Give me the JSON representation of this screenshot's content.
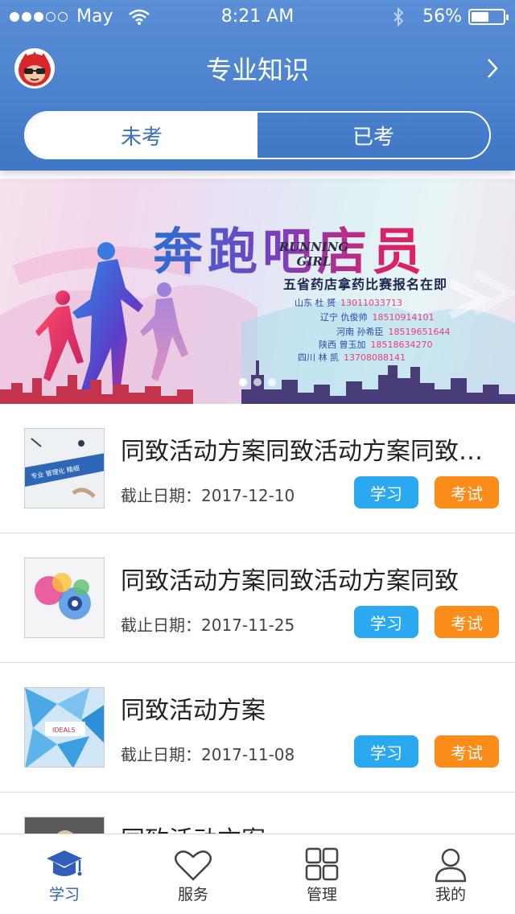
{
  "status_bar": {
    "carrier": "May",
    "time": "8:21 AM",
    "battery": "56%",
    "battery_level": 0.56
  },
  "header": {
    "title": "专业知识",
    "avatar_icon": "avatar-icon",
    "forward_icon": "chevron-right-icon"
  },
  "segments": [
    {
      "label": "未考",
      "active": true
    },
    {
      "label": "已考",
      "active": false
    }
  ],
  "banner": {
    "title": "奔跑吧店员",
    "english": "RUNNING GIRL",
    "subtitle": "五省药店拿药比赛报名在即",
    "contacts": [
      {
        "name": "山东 杜 赟",
        "phone": "13011033713"
      },
      {
        "name": "辽宁 仇俊帅",
        "phone": "18510914101"
      },
      {
        "name": "河南 孙希臣",
        "phone": "18519651644"
      },
      {
        "name": "陕西 曾玉加",
        "phone": "18518634270"
      },
      {
        "name": "四川 林 凯",
        "phone": "13708088141"
      }
    ],
    "page_index": 0,
    "page_count": 3
  },
  "list": {
    "deadline_prefix": "截止日期：",
    "study_label": "学习",
    "exam_label": "考试",
    "items": [
      {
        "title": "同致活动方案同致活动方案同致活动方案",
        "deadline": "2017-12-10",
        "thumb_text": "专业 管理化 精细"
      },
      {
        "title": "同致活动方案同致活动方案同致",
        "deadline": "2017-11-25",
        "thumb_text": ""
      },
      {
        "title": "同致活动方案",
        "deadline": "2017-11-08",
        "thumb_text": "IDEALS"
      },
      {
        "title": "同致活动方案",
        "deadline": "",
        "thumb_text": ""
      }
    ]
  },
  "tabbar": {
    "items": [
      {
        "label": "学习",
        "icon": "graduation-cap-icon",
        "active": true
      },
      {
        "label": "服务",
        "icon": "heart-icon",
        "active": false
      },
      {
        "label": "管理",
        "icon": "grid-icon",
        "active": false
      },
      {
        "label": "我的",
        "icon": "person-icon",
        "active": false
      }
    ]
  },
  "colors": {
    "header": "#4a82cc",
    "study_button": "#2aa9f1",
    "exam_button": "#fb8c1a",
    "active_tab": "#2f5fb8"
  }
}
